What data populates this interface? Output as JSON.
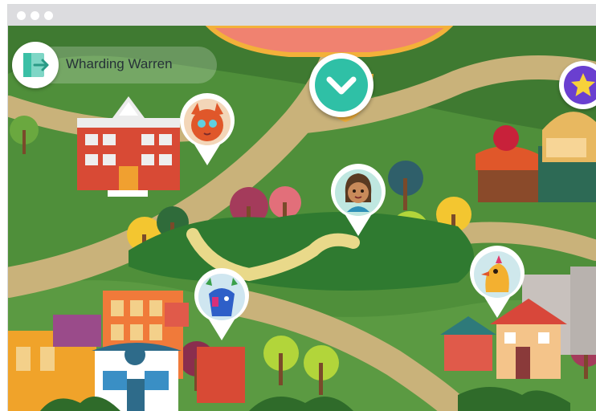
{
  "window": {
    "controls": [
      "window-dot",
      "window-dot",
      "window-dot"
    ]
  },
  "header": {
    "user_name": "Wharding Warren",
    "exit_icon": "exit-door-icon",
    "center_button_icon": "chevron-down-icon",
    "right_button_icon": "star-icon"
  },
  "map": {
    "locations": [
      {
        "name": "school",
        "icon": "school-building-icon"
      },
      {
        "name": "park",
        "icon": "park-icon"
      },
      {
        "name": "market",
        "icon": "market-stall-icon"
      },
      {
        "name": "city",
        "icon": "city-buildings-icon"
      },
      {
        "name": "cafe",
        "icon": "cafe-building-icon"
      },
      {
        "name": "houses",
        "icon": "house-icon"
      }
    ],
    "characters": [
      {
        "name": "red-cat",
        "icon": "red-cat-avatar-icon"
      },
      {
        "name": "girl",
        "icon": "girl-avatar-icon"
      },
      {
        "name": "blue-moose",
        "icon": "blue-moose-avatar-icon"
      },
      {
        "name": "yellow-bird",
        "icon": "yellow-bird-avatar-icon"
      }
    ]
  },
  "colors": {
    "grass": "#4f8f3a",
    "path": "#c9b27a",
    "accent_teal": "#2fc0a6",
    "accent_purple": "#6a3fd0",
    "chrome": "#dcdcdf"
  }
}
